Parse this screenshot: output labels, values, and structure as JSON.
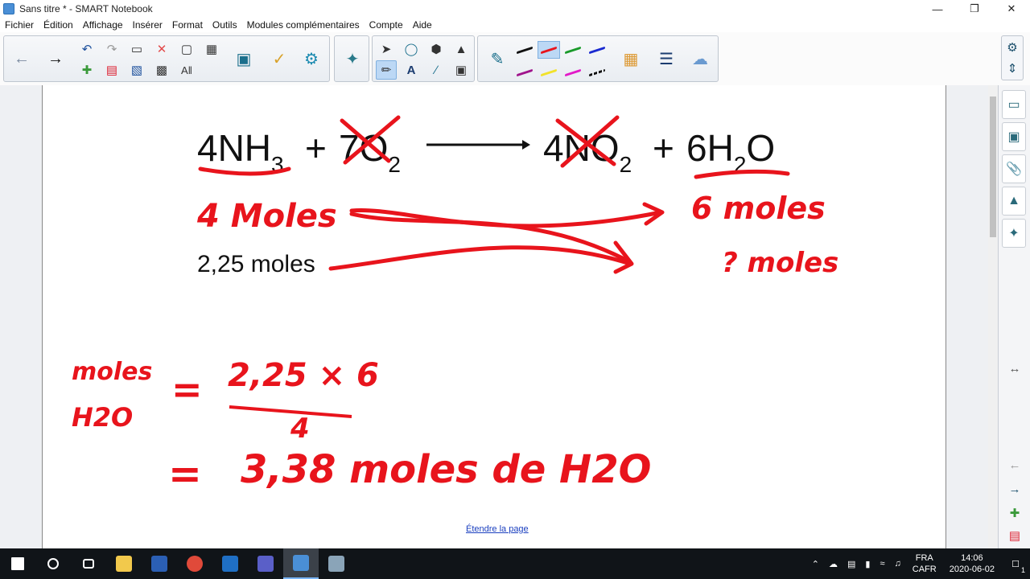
{
  "window": {
    "title": "Sans titre * - SMART Notebook",
    "minimize": "—",
    "restore": "❐",
    "close": "✕"
  },
  "menu": [
    "Fichier",
    "Édition",
    "Affichage",
    "Insérer",
    "Format",
    "Outils",
    "Modules complémentaires",
    "Compte",
    "Aide"
  ],
  "canvas": {
    "equation": {
      "reactant1": {
        "coef": "4NH",
        "sub": "3"
      },
      "plus1": "+",
      "reactant2": {
        "coef": "7O",
        "sub": "2"
      },
      "product1": {
        "coef": "4NO",
        "sub": "2"
      },
      "plus2": "+",
      "product2": {
        "coef": "6H",
        "sub": "2",
        "tail": "O"
      }
    },
    "typed_text": "2,25 moles",
    "handwriting": {
      "reactant_moles": "4 Moles",
      "product_moles": "6 moles",
      "unknown": "? moles",
      "lhs_top": "moles",
      "lhs_bottom": "H2O",
      "equals1": "=",
      "numerator": "2,25 × 6",
      "denominator": "4",
      "equals2": "=",
      "result": "3,38 moles de H2O"
    }
  },
  "extend_page_link": "Étendre la page",
  "taskbar": {
    "lang_top": "FRA",
    "lang_bottom": "CAFR",
    "time": "14:06",
    "date": "2020-06-02",
    "notifications": "1"
  },
  "colors": {
    "ink_red": "#e8141c",
    "link": "#1a3fbf"
  }
}
